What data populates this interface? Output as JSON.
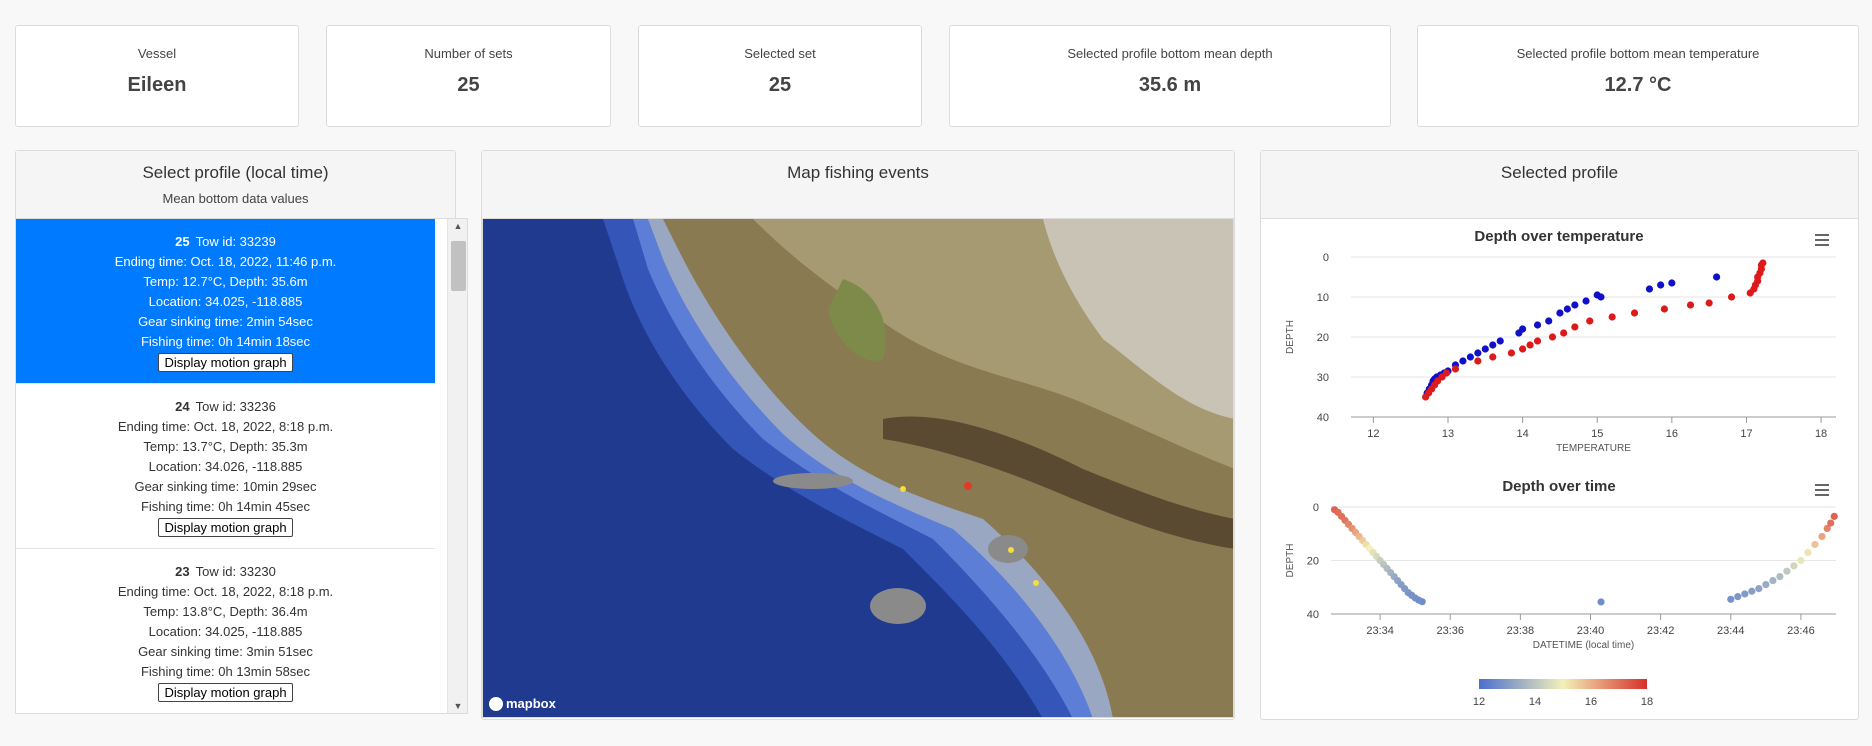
{
  "stats": {
    "vessel": {
      "label": "Vessel",
      "value": "Eileen"
    },
    "sets": {
      "label": "Number of sets",
      "value": "25"
    },
    "selected": {
      "label": "Selected set",
      "value": "25"
    },
    "depth": {
      "label": "Selected profile bottom mean depth",
      "value": "35.6 m"
    },
    "temp": {
      "label": "Selected profile bottom mean temperature",
      "value": "12.7 °C"
    }
  },
  "profile_panel": {
    "title": "Select profile (local time)",
    "subtitle": "Mean bottom data values",
    "button_label": "Display motion graph",
    "items": [
      {
        "num": "25",
        "tow": "Tow id: 33239",
        "ending": "Ending time: Oct. 18, 2022, 11:46 p.m.",
        "temp_depth": "Temp: 12.7°C, Depth: 35.6m",
        "location": "Location: 34.025, -118.885",
        "gear": "Gear sinking time: 2min 54sec",
        "fishing": "Fishing time: 0h 14min 18sec",
        "active": true
      },
      {
        "num": "24",
        "tow": "Tow id: 33236",
        "ending": "Ending time: Oct. 18, 2022, 8:18 p.m.",
        "temp_depth": "Temp: 13.7°C, Depth: 35.3m",
        "location": "Location: 34.026, -118.885",
        "gear": "Gear sinking time: 10min 29sec",
        "fishing": "Fishing time: 0h 14min 45sec",
        "active": false
      },
      {
        "num": "23",
        "tow": "Tow id: 33230",
        "ending": "Ending time: Oct. 18, 2022, 8:18 p.m.",
        "temp_depth": "Temp: 13.8°C, Depth: 36.4m",
        "location": "Location: 34.025, -118.885",
        "gear": "Gear sinking time: 3min 51sec",
        "fishing": "Fishing time: 0h 13min 58sec",
        "active": false
      }
    ]
  },
  "map_panel": {
    "title": "Map fishing events",
    "attribution": "mapbox",
    "colors": {
      "deep": "#1f3a8f",
      "mid": "#3456b8",
      "shelf": "#5d7ed6",
      "shelf_edge": "#9aa7c2",
      "land": "#8a7a52",
      "land_dark": "#5b4a32"
    }
  },
  "selected_panel": {
    "title": "Selected profile",
    "menu_icon": "hamburger-icon"
  },
  "chart_data": [
    {
      "type": "scatter",
      "title": "Depth over temperature",
      "xlabel": "TEMPERATURE",
      "ylabel": "DEPTH",
      "xlim": [
        11.7,
        18.2
      ],
      "ylim": [
        0,
        40
      ],
      "y_reversed": true,
      "xticks": [
        12,
        13,
        14,
        15,
        16,
        17,
        18
      ],
      "yticks": [
        0,
        10,
        20,
        30,
        40
      ],
      "series": [
        {
          "color": "#1010c8",
          "points": [
            [
              12.72,
              34
            ],
            [
              12.75,
              33
            ],
            [
              12.78,
              32
            ],
            [
              12.8,
              31
            ],
            [
              12.82,
              30.5
            ],
            [
              12.85,
              30
            ],
            [
              12.9,
              29.5
            ],
            [
              12.95,
              29
            ],
            [
              13.0,
              28.5
            ],
            [
              13.1,
              27
            ],
            [
              13.2,
              26
            ],
            [
              13.3,
              25
            ],
            [
              13.4,
              24
            ],
            [
              13.5,
              23
            ],
            [
              13.6,
              22
            ],
            [
              13.7,
              21
            ],
            [
              13.95,
              19
            ],
            [
              14.0,
              18
            ],
            [
              14.2,
              17
            ],
            [
              14.35,
              16
            ],
            [
              14.5,
              14
            ],
            [
              14.6,
              13
            ],
            [
              14.7,
              12
            ],
            [
              14.85,
              11
            ],
            [
              15.0,
              9.5
            ],
            [
              15.05,
              10
            ],
            [
              15.7,
              8
            ],
            [
              15.85,
              7
            ],
            [
              16.0,
              6.5
            ],
            [
              16.6,
              5
            ]
          ]
        },
        {
          "color": "#dd1a1a",
          "points": [
            [
              12.7,
              35
            ],
            [
              12.74,
              34
            ],
            [
              12.78,
              33
            ],
            [
              12.82,
              32
            ],
            [
              12.86,
              31
            ],
            [
              12.92,
              30
            ],
            [
              12.98,
              29
            ],
            [
              13.1,
              28
            ],
            [
              13.4,
              26
            ],
            [
              13.6,
              25
            ],
            [
              13.85,
              24
            ],
            [
              14.0,
              23
            ],
            [
              14.1,
              22
            ],
            [
              14.2,
              21
            ],
            [
              14.4,
              20
            ],
            [
              14.55,
              19
            ],
            [
              14.7,
              17.5
            ],
            [
              14.9,
              16
            ],
            [
              15.2,
              15
            ],
            [
              15.5,
              14
            ],
            [
              15.9,
              13
            ],
            [
              16.25,
              12
            ],
            [
              16.5,
              11.5
            ],
            [
              16.8,
              10
            ],
            [
              17.05,
              9
            ],
            [
              17.1,
              8
            ],
            [
              17.12,
              7
            ],
            [
              17.15,
              6
            ],
            [
              17.15,
              5
            ],
            [
              17.18,
              4
            ],
            [
              17.2,
              3
            ],
            [
              17.2,
              2
            ],
            [
              17.22,
              1.5
            ]
          ]
        }
      ]
    },
    {
      "type": "scatter",
      "title": "Depth over time",
      "xlabel": "DATETIME (local time)",
      "ylabel": "DEPTH",
      "ylim": [
        0,
        40
      ],
      "y_reversed": true,
      "xtick_labels": [
        "23:34",
        "23:36",
        "23:38",
        "23:40",
        "23:42",
        "23:44",
        "23:46"
      ],
      "xlim_minutes": [
        32.6,
        47.0
      ],
      "yticks": [
        0,
        20,
        40
      ],
      "color_axis": {
        "min": 12,
        "max": 18,
        "ticks": [
          12,
          14,
          16,
          18
        ],
        "colors": [
          "#4a6fcf",
          "#f3f0b8",
          "#d7302a"
        ]
      },
      "points_minutes_depth_temp": [
        [
          32.7,
          1,
          17.2
        ],
        [
          32.8,
          2,
          17.1
        ],
        [
          32.9,
          3.5,
          17.0
        ],
        [
          33.0,
          5,
          16.9
        ],
        [
          33.1,
          6.5,
          16.7
        ],
        [
          33.2,
          8,
          16.5
        ],
        [
          33.3,
          9.5,
          16.2
        ],
        [
          33.4,
          11,
          15.9
        ],
        [
          33.5,
          12.5,
          15.6
        ],
        [
          33.6,
          14,
          15.3
        ],
        [
          33.7,
          15.5,
          15.0
        ],
        [
          33.8,
          17,
          14.7
        ],
        [
          33.9,
          18.5,
          14.5
        ],
        [
          34.0,
          20,
          14.2
        ],
        [
          34.1,
          21.5,
          14.0
        ],
        [
          34.2,
          23,
          13.8
        ],
        [
          34.3,
          24.5,
          13.6
        ],
        [
          34.4,
          26,
          13.4
        ],
        [
          34.5,
          27.5,
          13.2
        ],
        [
          34.6,
          29,
          13.1
        ],
        [
          34.7,
          30.5,
          13.0
        ],
        [
          34.8,
          32,
          12.9
        ],
        [
          34.9,
          33,
          12.8
        ],
        [
          35.0,
          34,
          12.8
        ],
        [
          35.1,
          34.8,
          12.7
        ],
        [
          35.2,
          35.4,
          12.7
        ],
        [
          40.3,
          35.5,
          12.7
        ],
        [
          44.0,
          34.5,
          12.8
        ],
        [
          44.2,
          33.5,
          12.9
        ],
        [
          44.4,
          32.5,
          13.0
        ],
        [
          44.6,
          31.5,
          13.1
        ],
        [
          44.8,
          30.5,
          13.2
        ],
        [
          45.0,
          29,
          13.4
        ],
        [
          45.2,
          27.5,
          13.6
        ],
        [
          45.4,
          26,
          13.8
        ],
        [
          45.6,
          24,
          14.1
        ],
        [
          45.8,
          22,
          14.4
        ],
        [
          46.0,
          20,
          14.8
        ],
        [
          46.2,
          17,
          15.2
        ],
        [
          46.4,
          14,
          15.7
        ],
        [
          46.6,
          11,
          16.2
        ],
        [
          46.75,
          8,
          16.7
        ],
        [
          46.85,
          6,
          17.0
        ],
        [
          46.95,
          3.5,
          17.2
        ]
      ]
    }
  ]
}
